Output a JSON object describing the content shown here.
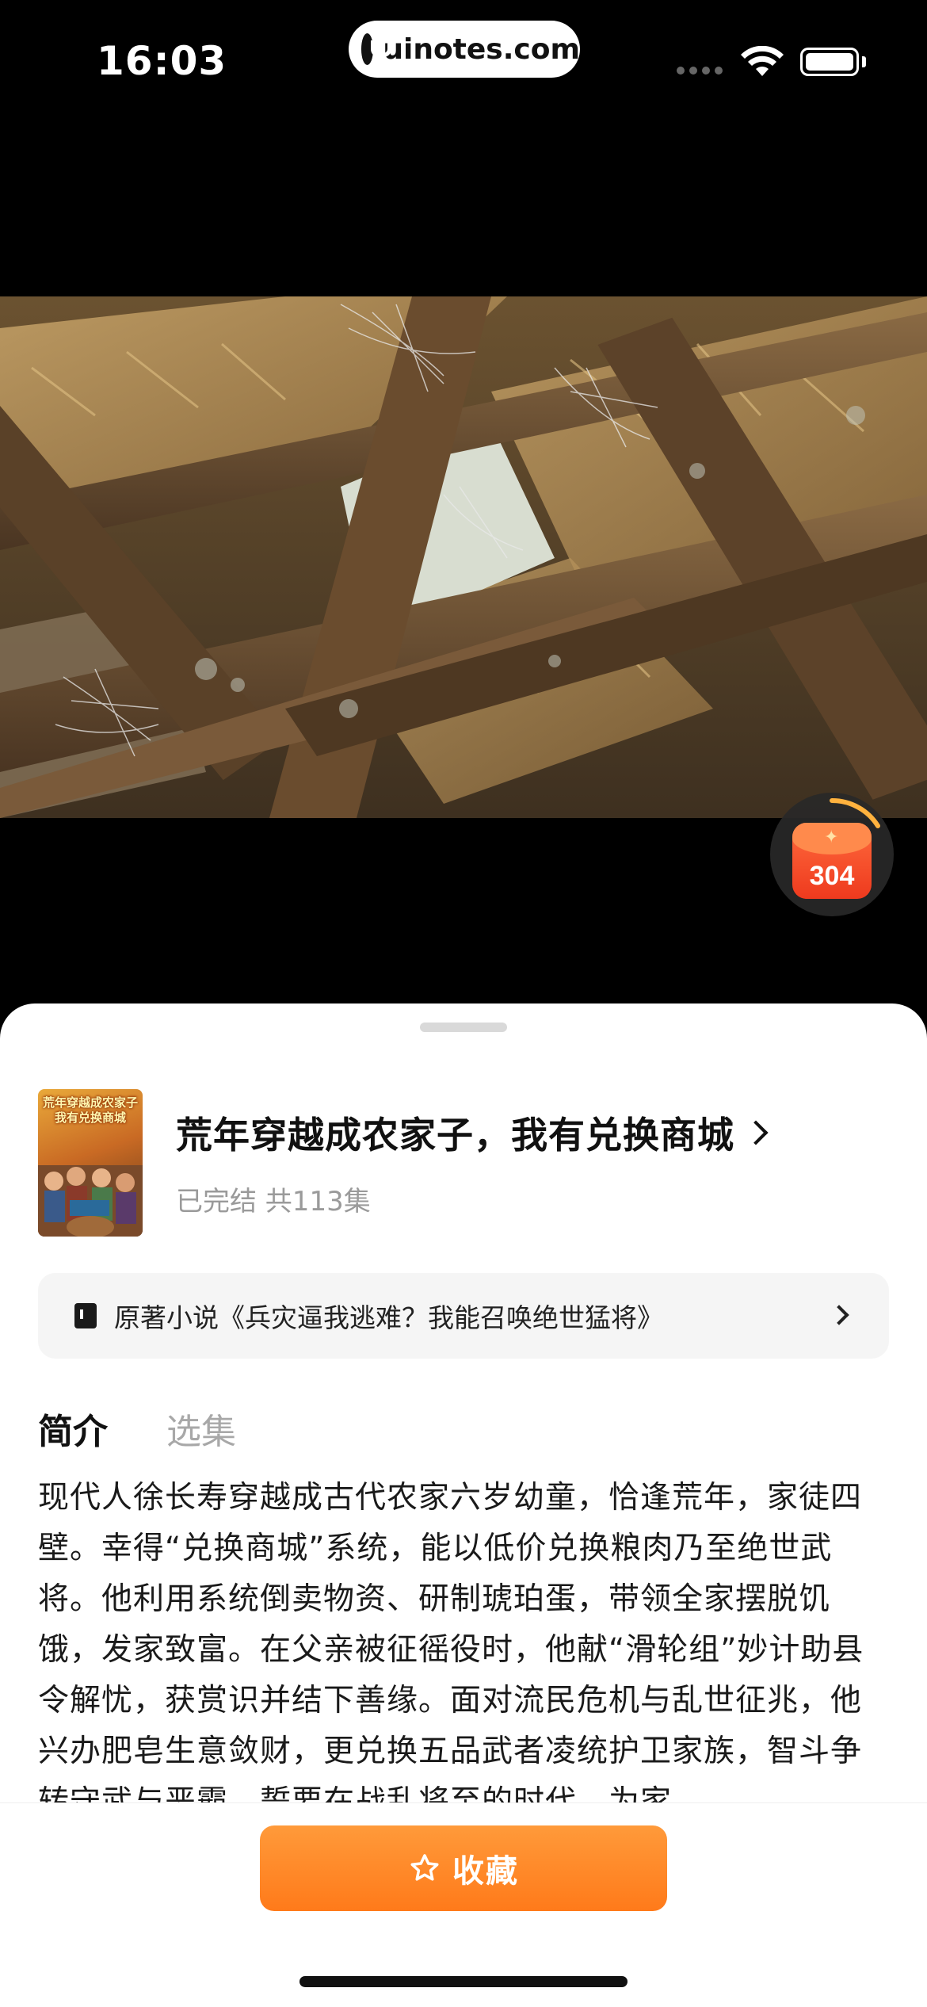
{
  "status_bar": {
    "time": "16:03",
    "url": "uinotes.com",
    "icons": [
      "signal-icon",
      "wifi-icon",
      "battery-icon"
    ]
  },
  "video": {
    "description_icon": "video-frame"
  },
  "reward": {
    "count": "304"
  },
  "show": {
    "title": "荒年穿越成农家子，我有兑换商城",
    "meta": "已完结 共113集",
    "cover_text": "荒年穿越成农家子我有兑换商城"
  },
  "novel": {
    "text": "原著小说《兵灾逼我逃难？我能召唤绝世猛将》"
  },
  "tabs": {
    "intro": "简介",
    "episodes": "选集"
  },
  "synopsis": "现代人徐长寿穿越成古代农家六岁幼童，恰逢荒年，家徒四壁。幸得“兑换商城”系统，能以低价兑换粮肉乃至绝世武将。他利用系统倒卖物资、研制琥珀蛋，带领全家摆脱饥饿，发家致富。在父亲被征徭役时，他献“滑轮组”妙计助县令解忧，获赏识并结下善缘。面对流民危机与乱世征兆，他兴办肥皂生意敛财，更兑换五品武者凌统护卫家族，智斗争转守武与恶霸，誓要在战乱将至的时代，为家",
  "actions": {
    "favorite": "收藏"
  },
  "colors": {
    "accent": "#ff8a2a",
    "sheet_bg": "#ffffff",
    "novel_bg": "#f5f5f5"
  }
}
